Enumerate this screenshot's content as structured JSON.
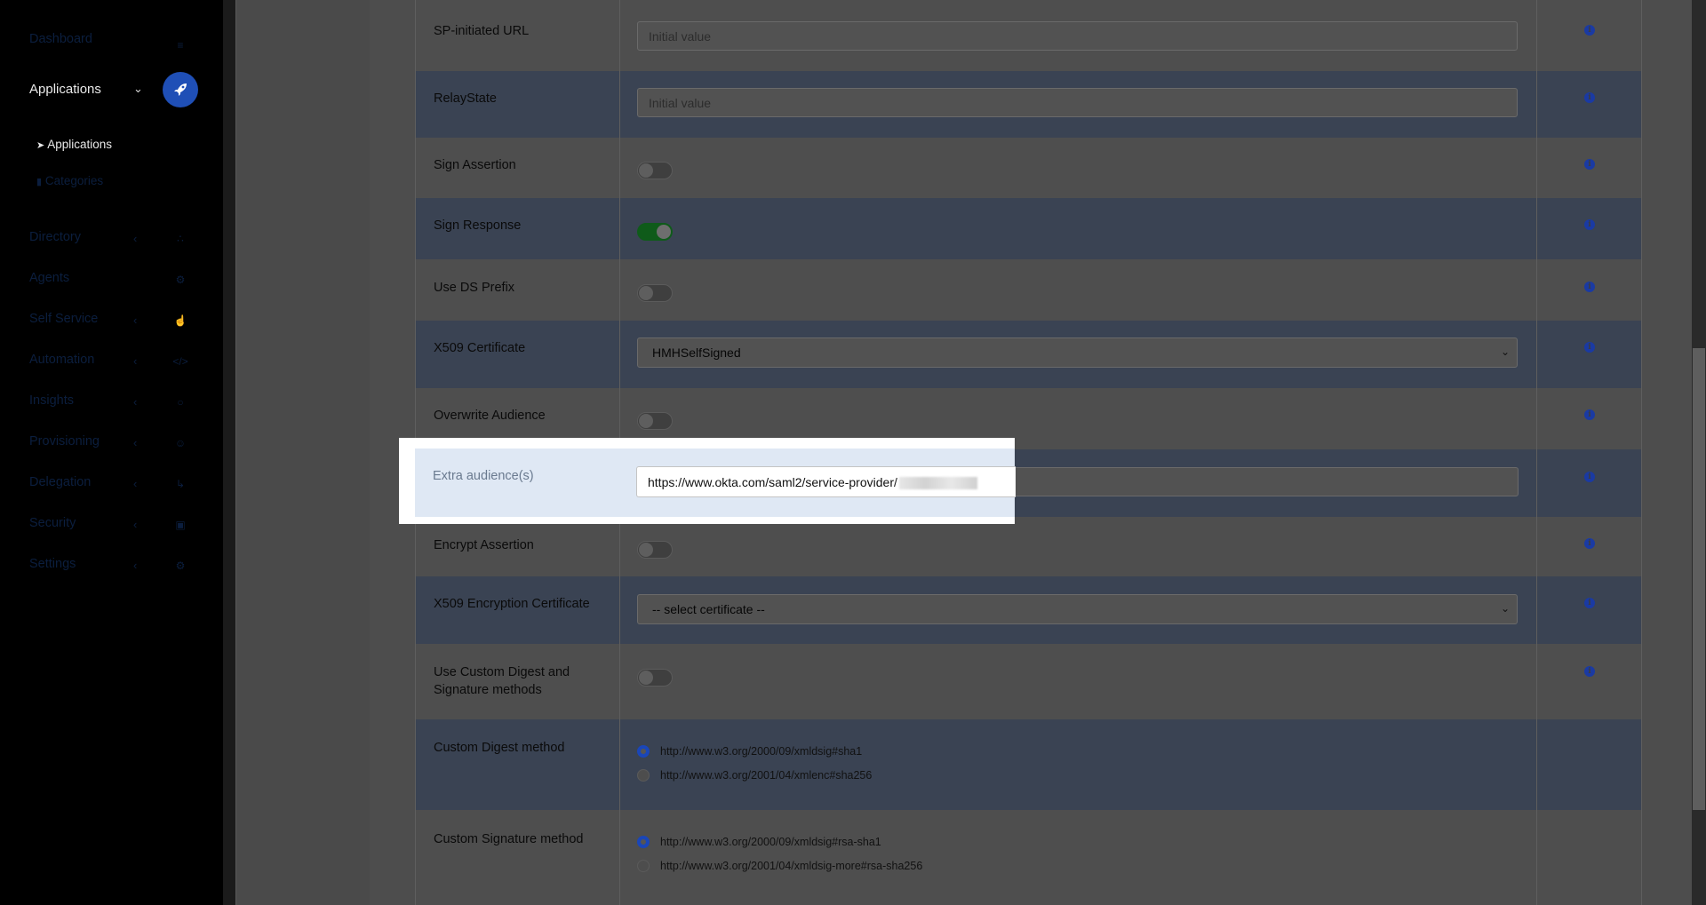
{
  "sidebar": {
    "items": [
      {
        "label": "Dashboard",
        "icon": "dashboard-icon"
      },
      {
        "label": "Applications",
        "icon": "rocket-icon"
      },
      {
        "label": "Directory",
        "icon": "sitemap-icon"
      },
      {
        "label": "Agents",
        "icon": "agents-icon"
      },
      {
        "label": "Self Service",
        "icon": "hand-icon"
      },
      {
        "label": "Automation",
        "icon": "code-icon"
      },
      {
        "label": "Insights",
        "icon": "lightbulb-icon"
      },
      {
        "label": "Provisioning",
        "icon": "users-icon"
      },
      {
        "label": "Delegation",
        "icon": "delegation-icon"
      },
      {
        "label": "Security",
        "icon": "lock-icon"
      },
      {
        "label": "Settings",
        "icon": "gear-icon"
      }
    ],
    "sub_items": [
      {
        "label": "Applications"
      },
      {
        "label": "Categories"
      }
    ]
  },
  "form": {
    "sp_initiated_url": {
      "label": "SP-initiated URL",
      "placeholder": "Initial value"
    },
    "relay_state": {
      "label": "RelayState",
      "placeholder": "Initial value"
    },
    "sign_assertion": {
      "label": "Sign Assertion",
      "on": false
    },
    "sign_response": {
      "label": "Sign Response",
      "on": true
    },
    "use_ds_prefix": {
      "label": "Use DS Prefix",
      "on": false
    },
    "x509_certificate": {
      "label": "X509 Certificate",
      "value": "HMHSelfSigned"
    },
    "overwrite_audience": {
      "label": "Overwrite Audience",
      "on": false
    },
    "extra_audiences": {
      "label": "Extra audience(s)",
      "value": "https://www.okta.com/saml2/service-provider/"
    },
    "encrypt_assertion": {
      "label": "Encrypt Assertion",
      "on": false
    },
    "x509_encryption_certificate": {
      "label": "X509 Encryption Certificate",
      "value": "-- select certificate --"
    },
    "use_custom_methods": {
      "label_line1": "Use Custom Digest and",
      "label_line2": "Signature methods",
      "on": false
    },
    "custom_digest_method": {
      "label": "Custom Digest method",
      "options": [
        "http://www.w3.org/2000/09/xmldsig#sha1",
        "http://www.w3.org/2001/04/xmlenc#sha256"
      ],
      "selected": 0
    },
    "custom_signature_method": {
      "label": "Custom Signature method",
      "options": [
        "http://www.w3.org/2000/09/xmldsig#rsa-sha1",
        "http://www.w3.org/2001/04/xmldsig-more#rsa-sha256"
      ],
      "selected": 0
    }
  },
  "colors": {
    "accent": "#1f4fb6",
    "toggle_on": "#0f5b1a"
  }
}
